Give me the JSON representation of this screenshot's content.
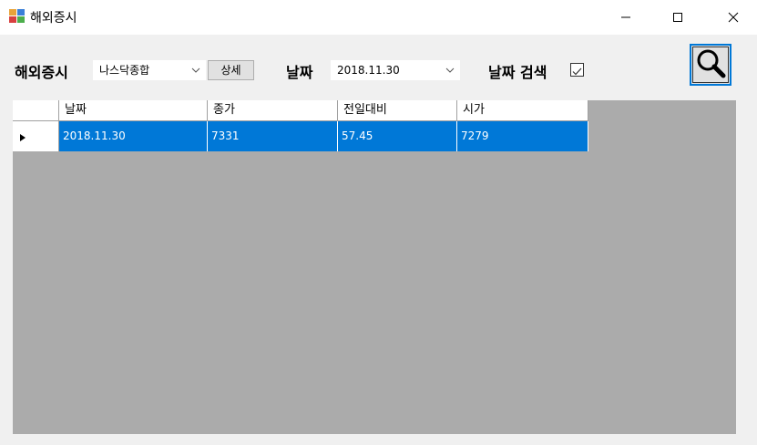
{
  "window": {
    "title": "해외증시",
    "icon": "app-window-icon",
    "controls": {
      "minimize_icon": "minimize-icon",
      "maximize_icon": "maximize-icon",
      "close_icon": "close-icon"
    }
  },
  "toolbar": {
    "market_label": "해외증시",
    "market_selected": "나스닥종합",
    "detail_button": "상세",
    "date_label": "날짜",
    "date_selected": "2018.11.30",
    "date_search_label": "날짜 검색",
    "date_search_checked": true,
    "search_icon": "magnifier-icon"
  },
  "grid": {
    "columns": [
      "날짜",
      "종가",
      "전일대비",
      "시가"
    ],
    "rows": [
      {
        "date": "2018.11.30",
        "close": "7331",
        "change": "57.45",
        "open": "7279",
        "selected": true
      }
    ]
  },
  "colors": {
    "selection": "#0078d7",
    "grid_background": "#ababab",
    "accent_border": "#0078d7"
  }
}
